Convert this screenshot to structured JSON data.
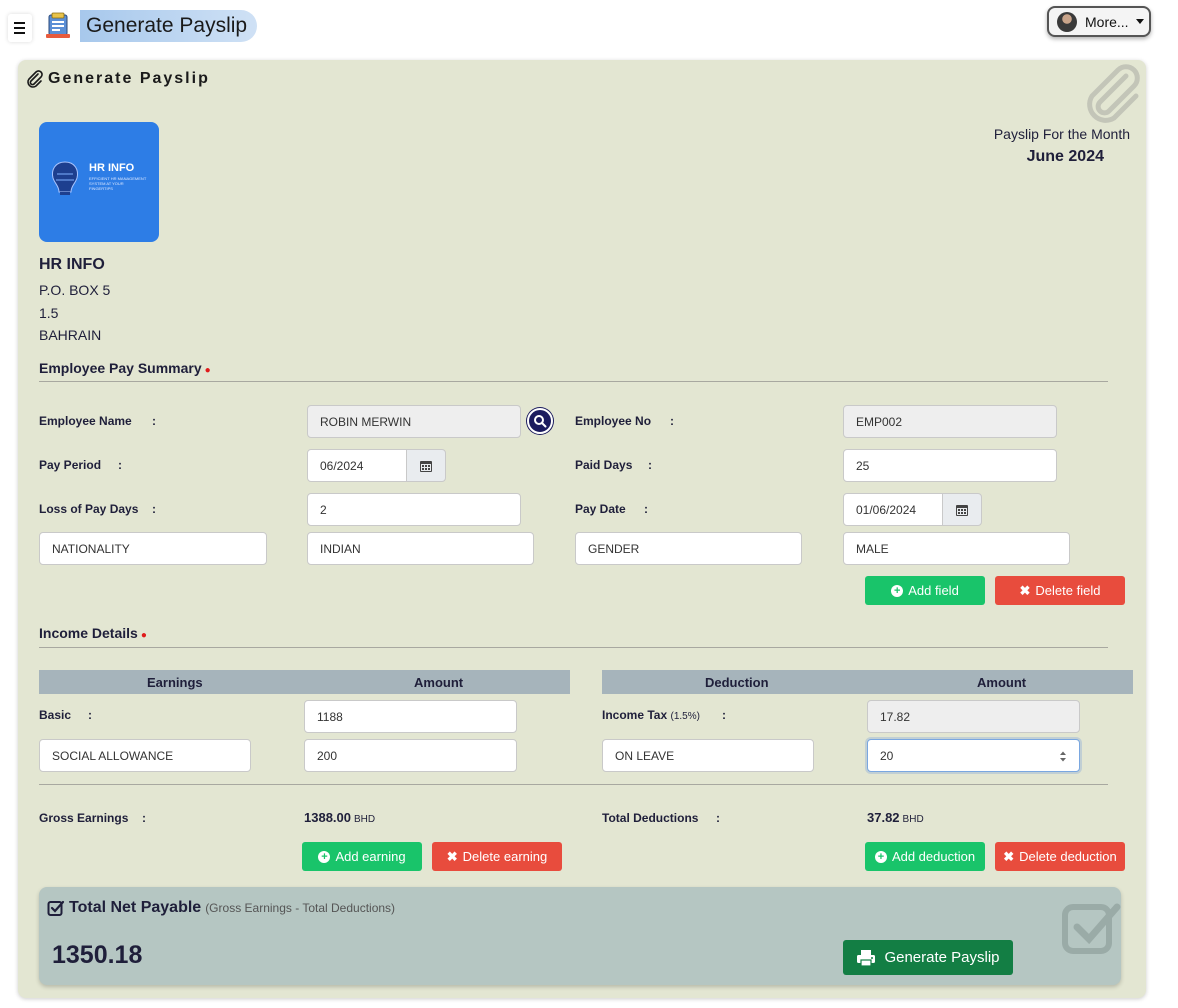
{
  "header": {
    "title": "Generate Payslip",
    "more_label": "More...",
    "icons": {
      "menu": "hamburger-icon",
      "title": "payslip-icon",
      "avatar": "user-avatar"
    }
  },
  "panel": {
    "heading": "Generate Payslip",
    "icons": {
      "heading": "paperclip-icon"
    }
  },
  "company": {
    "logo_title": "HR INFO",
    "logo_subtitle": "EFFICIENT HR MANAGEMENT SYSTEM AT YOUR FINGERTIPS",
    "name": "HR INFO",
    "address_line1": "P.O. BOX 5",
    "address_line2": "1.5",
    "address_line3": "BAHRAIN"
  },
  "payslip": {
    "for_label": "Payslip For the Month",
    "month": "June 2024"
  },
  "summary": {
    "title": "Employee Pay Summary",
    "employee_name_label": "Employee Name",
    "employee_name": "ROBIN MERWIN",
    "employee_no_label": "Employee No",
    "employee_no": "EMP002",
    "pay_period_label": "Pay Period",
    "pay_period": "06/2024",
    "paid_days_label": "Paid Days",
    "paid_days": "25",
    "lop_label": "Loss of Pay Days",
    "lop_days": "2",
    "pay_date_label": "Pay Date",
    "pay_date": "01/06/2024",
    "custom_fields": [
      {
        "name": "NATIONALITY",
        "value": "INDIAN"
      },
      {
        "name": "GENDER",
        "value": "MALE"
      }
    ],
    "add_field": "Add field",
    "delete_field": "Delete field",
    "colon": ":"
  },
  "income": {
    "title": "Income Details",
    "earnings_header": "Earnings",
    "amount_header": "Amount",
    "deduction_header": "Deduction",
    "basic_label": "Basic",
    "basic_value": "1188",
    "earning_custom_name": "SOCIAL ALLOWANCE",
    "earning_custom_value": "200",
    "income_tax_label": "Income Tax",
    "income_tax_rate": "(1.5%)",
    "income_tax_value": "17.82",
    "deduction_custom_name": "ON LEAVE",
    "deduction_custom_value": "20",
    "gross_label": "Gross Earnings",
    "gross_value": "1388.00",
    "total_ded_label": "Total Deductions",
    "total_ded_value": "37.82",
    "currency": "BHD",
    "add_earning": "Add earning",
    "delete_earning": "Delete earning",
    "add_deduction": "Add deduction",
    "delete_deduction": "Delete deduction"
  },
  "net": {
    "title": "Total Net Payable",
    "subtitle": "(Gross Earnings - Total Deductions)",
    "value": "1350.18",
    "generate_label": "Generate Payslip"
  },
  "colors": {
    "panel_bg": "#e3e6d2",
    "table_header": "#a6b4bb",
    "net_box": "#b5c6c2",
    "green": "#19c46a",
    "red": "#e84c3d",
    "dark_green": "#137e44",
    "logo_blue": "#2d7de6"
  }
}
